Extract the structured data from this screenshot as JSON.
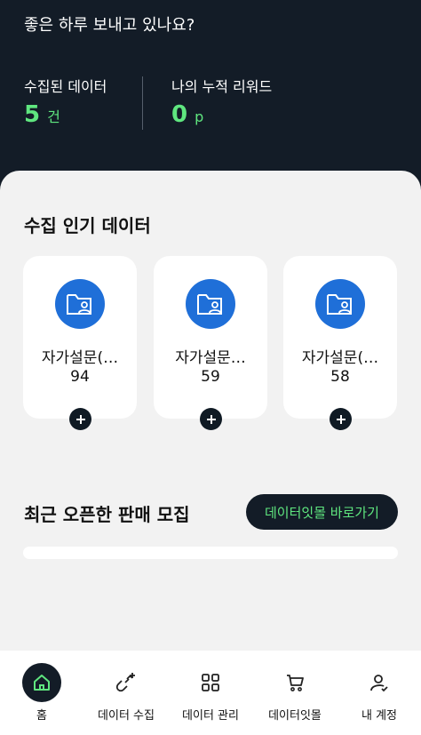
{
  "header": {
    "greeting": "좋은 하루 보내고 있나요?",
    "collected_label": "수집된 데이터",
    "collected_value": "5",
    "collected_unit": "건",
    "reward_label": "나의 누적 리워드",
    "reward_value": "0",
    "reward_unit": "p"
  },
  "popular": {
    "title": "수집 인기 데이터",
    "cards": [
      {
        "name": "자가설문(…",
        "count": "94",
        "icon": "folder-user-icon"
      },
      {
        "name": "자가설문…",
        "count": "59",
        "icon": "folder-user-icon"
      },
      {
        "name": "자가설문(…",
        "count": "58",
        "icon": "folder-user-icon"
      }
    ]
  },
  "recent": {
    "title": "최근 오픈한 판매 모집",
    "mall_button": "데이터잇몰 바로가기"
  },
  "nav": {
    "items": [
      {
        "label": "홈",
        "icon": "home-icon"
      },
      {
        "label": "데이터 수집",
        "icon": "collect-icon"
      },
      {
        "label": "데이터 관리",
        "icon": "grid-icon"
      },
      {
        "label": "데이터잇몰",
        "icon": "cart-icon"
      },
      {
        "label": "내 계정",
        "icon": "user-icon"
      }
    ]
  },
  "colors": {
    "header_bg": "#131c27",
    "accent_green": "#5fe67f",
    "icon_blue": "#1f6fd8"
  }
}
